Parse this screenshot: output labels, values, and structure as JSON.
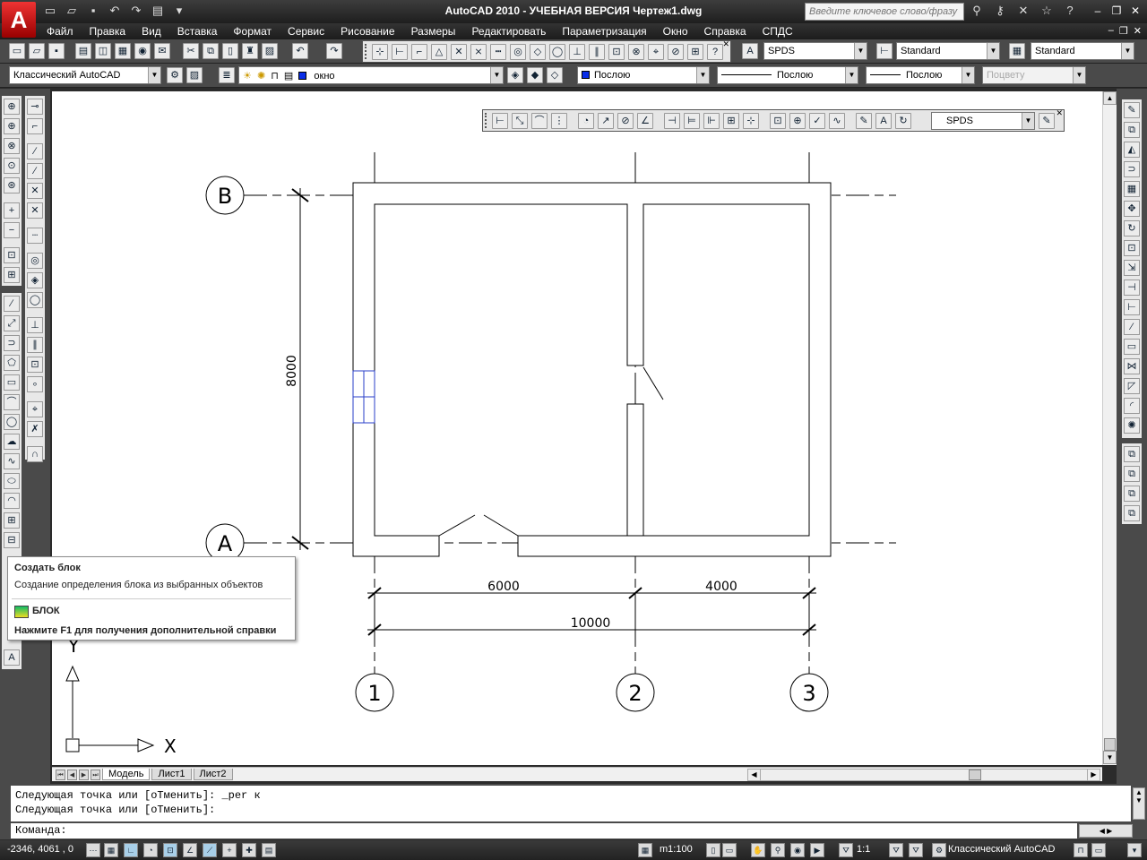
{
  "titlebar": {
    "title": "AutoCAD 2010 - УЧЕБНАЯ ВЕРСИЯ    Чертеж1.dwg",
    "logo_letter": "A",
    "search_placeholder": "Введите ключевое слово/фразу"
  },
  "menubar": {
    "items": [
      "Файл",
      "Правка",
      "Вид",
      "Вставка",
      "Формат",
      "Сервис",
      "Рисование",
      "Размеры",
      "Редактировать",
      "Параметризация",
      "Окно",
      "Справка",
      "СПДС"
    ]
  },
  "toolbar1": {
    "textstyle_value": "SPDS",
    "dimstyle_value": "Standard",
    "tablestyle_value": "Standard"
  },
  "toolbar2": {
    "workspace_value": "Классический AutoCAD",
    "layer_value": "окно",
    "color_value": "Послою",
    "linetype_value": "Послою",
    "lineweight_value": "Послою",
    "plotstyle_value": "Поцвету"
  },
  "dimension_toolbar": {
    "dimstyle_value": "SPDS"
  },
  "drawing": {
    "axis_labels": {
      "B": "В",
      "A": "А",
      "one": "1",
      "two": "2",
      "three": "3"
    },
    "dimensions": {
      "vertical": "8000",
      "span1": "6000",
      "span2": "4000",
      "total": "10000"
    },
    "ucs": {
      "x_label": "X",
      "y_label": "Y"
    }
  },
  "tabs": {
    "items": [
      "Модель",
      "Лист1",
      "Лист2"
    ]
  },
  "command": {
    "history": [
      "Следующая точка или [оТменить]: _per к",
      "Следующая точка или [оТменить]:"
    ],
    "prompt": "Команда:"
  },
  "statusbar": {
    "coordinates": "-2346, 4061 , 0",
    "scale": "m1:100",
    "annotation_scale": "1:1",
    "workspace": "Классический AutoCAD"
  },
  "tooltip": {
    "title": "Создать блок",
    "description": "Создание определения блока из выбранных объектов",
    "command_name": "БЛОК",
    "f1_hint": "Нажмите F1 для получения дополнительной справки"
  },
  "colors": {
    "layer_swatch": "#0a2ee8",
    "window_block": "#2a3fc8",
    "title_bg": "#1e1e1e",
    "logo_red": "#cc1111"
  }
}
